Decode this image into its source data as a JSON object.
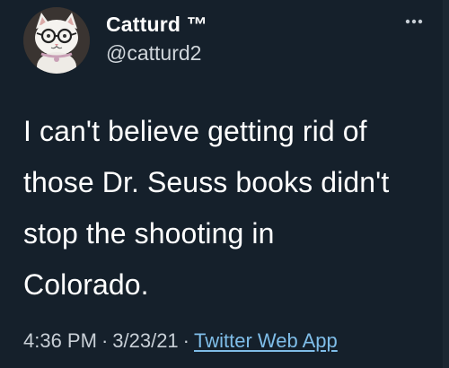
{
  "user": {
    "display_name": "Catturd ™",
    "handle": "@catturd2",
    "avatar_icon": "cat-with-glasses-avatar"
  },
  "tweet": {
    "text": "I can't believe getting rid of\nthose Dr. Seuss books didn't\nstop the shooting in\nColorado."
  },
  "meta": {
    "time": "4:36 PM",
    "separator": "·",
    "date": "3/23/21",
    "source": "Twitter Web App"
  },
  "menu": {
    "icon": "more-horizontal-icon"
  },
  "colors": {
    "background": "#15202b",
    "text": "#ffffff",
    "muted": "#c8cfd6",
    "link": "#7fbde8"
  }
}
